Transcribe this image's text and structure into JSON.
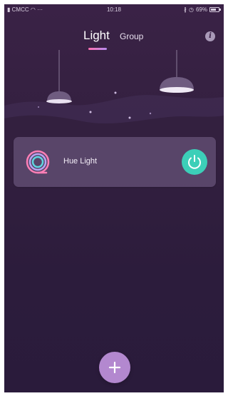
{
  "status_bar": {
    "carrier": "CMCC",
    "signal_extra": "···",
    "time": "10:18",
    "battery_percent": "69%",
    "battery_level": 0.69
  },
  "tabs": [
    {
      "label": "Light",
      "active": true
    },
    {
      "label": "Group",
      "active": false
    }
  ],
  "info_button": {
    "icon": "info-icon"
  },
  "devices": [
    {
      "name": "Hue Light",
      "icon": "hue-light-ring-icon",
      "power_state": "on"
    }
  ],
  "add_button": {
    "icon": "plus-icon"
  },
  "colors": {
    "background_top": "#3a2246",
    "background_bottom": "#2a1b3b",
    "accent_power": "#3ccfb8",
    "accent_add": "#b388cf",
    "tab_indicator_start": "#ff6fb0",
    "tab_indicator_end": "#b58cf0"
  }
}
